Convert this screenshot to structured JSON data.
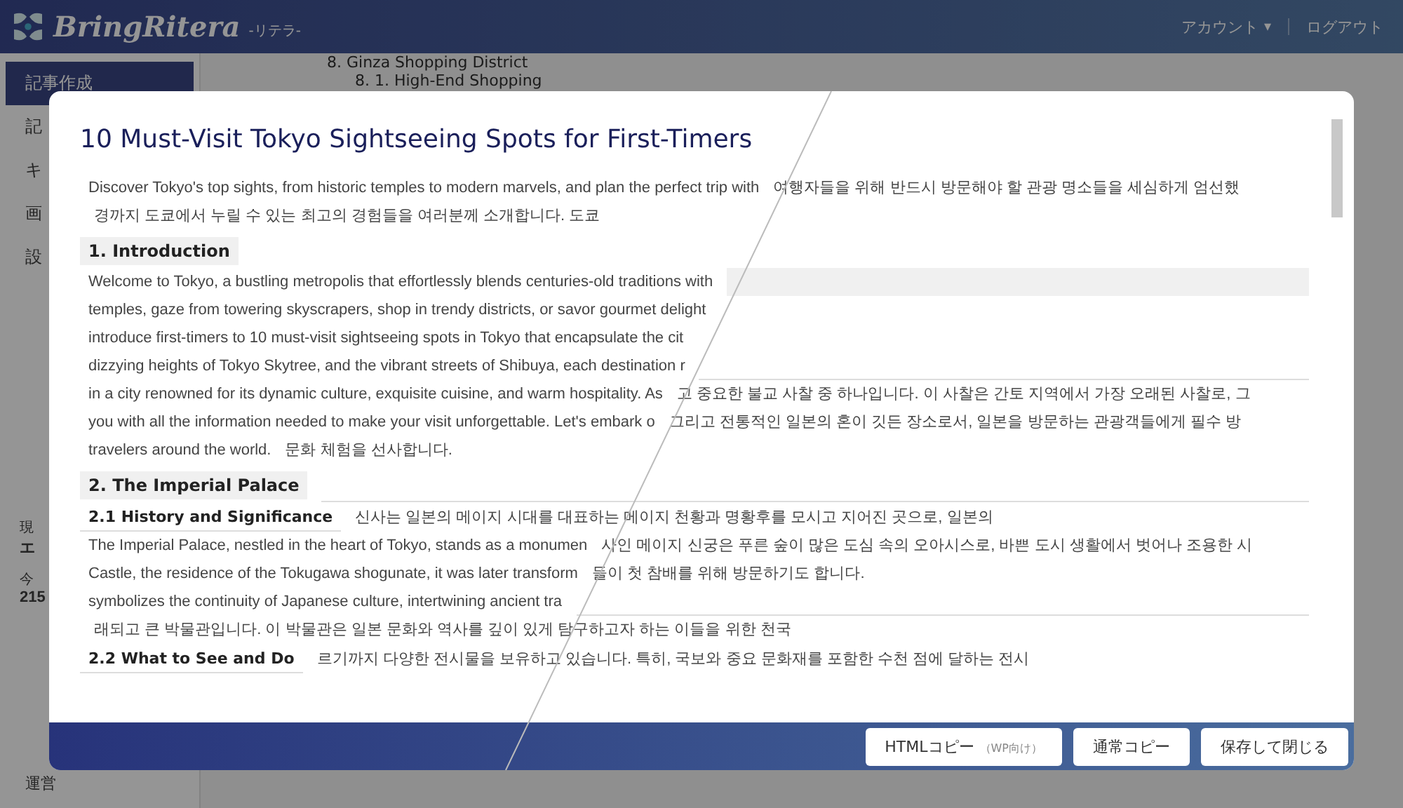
{
  "header": {
    "logo": "BringRitera",
    "logo_sub": "-リテラ-",
    "account": "アカウント",
    "account_caret": "▾",
    "logout": "ログアウト"
  },
  "sidebar": {
    "items": [
      {
        "label": "記事作成",
        "selected": true
      },
      {
        "label": "記",
        "selected": false
      },
      {
        "label": "キ",
        "selected": false
      },
      {
        "label": "画",
        "selected": false
      },
      {
        "label": "設",
        "selected": false
      }
    ],
    "stats": [
      {
        "label": "現",
        "value": "エ"
      },
      {
        "label": "今",
        "value": "215"
      }
    ],
    "footer_link": "運営"
  },
  "background": {
    "outline": [
      "8. Ginza Shopping District",
      "8. 1. High-End Shopping"
    ]
  },
  "modal": {
    "title": "10 Must-Visit Tokyo Sightseeing Spots for First-Timers",
    "rows": [
      {
        "left": {
          "kind": "body",
          "text": "Discover Tokyo's top sights, from historic temples to modern marvels, and plan the perfect trip with"
        },
        "right": {
          "kind": "body",
          "text": "여행자들을 위해 반드시 방문해야 할 관광 명소들을 세심하게 엄선했"
        }
      },
      {
        "left": {
          "kind": "blank"
        },
        "right": {
          "kind": "body",
          "text": "경까지 도쿄에서 누릴 수 있는 최고의 경험들을 여러분께 소개합니다. 도쿄"
        }
      },
      {
        "left": {
          "kind": "heading",
          "text": "1. Introduction"
        },
        "right": {
          "kind": "blank"
        }
      },
      {
        "left": {
          "kind": "body",
          "text": "Welcome to Tokyo, a bustling metropolis that effortlessly blends centuries-old traditions with"
        },
        "right": {
          "kind": "band"
        }
      },
      {
        "left": {
          "kind": "body",
          "text": "temples, gaze from towering skyscrapers, shop in trendy districts, or savor gourmet delight"
        },
        "right": {
          "kind": "blank"
        }
      },
      {
        "left": {
          "kind": "body",
          "text": "introduce first-timers to 10 must-visit sightseeing spots in Tokyo that encapsulate the cit"
        },
        "right": {
          "kind": "blank"
        }
      },
      {
        "left": {
          "kind": "body",
          "text": "dizzying heights of Tokyo Skytree, and the vibrant streets of Shibuya, each destination r"
        },
        "right": {
          "kind": "rule"
        }
      },
      {
        "left": {
          "kind": "body",
          "text": "in a city renowned for its dynamic culture, exquisite cuisine, and warm hospitality. As"
        },
        "right": {
          "kind": "body",
          "text": "고 중요한 불교 사찰 중 하나입니다. 이 사찰은 간토 지역에서 가장 오래된 사찰로, 그"
        }
      },
      {
        "left": {
          "kind": "body",
          "text": "you with all the information needed to make your visit unforgettable. Let's embark o"
        },
        "right": {
          "kind": "body",
          "text": "그리고 전통적인 일본의 혼이 깃든 장소로서, 일본을 방문하는 관광객들에게 필수 방"
        }
      },
      {
        "left": {
          "kind": "body",
          "text": "travelers around the world."
        },
        "right": {
          "kind": "body",
          "text": "문화 체험을 선사합니다."
        }
      },
      {
        "left": {
          "kind": "heading",
          "text": "2. The Imperial Palace"
        },
        "right": {
          "kind": "rule"
        }
      },
      {
        "left": {
          "kind": "subheading",
          "text": "2.1 History and Significance"
        },
        "right": {
          "kind": "body",
          "text": "신사는 일본의 메이지 시대를 대표하는 메이지 천황과 명황후를 모시고 지어진 곳으로, 일본의"
        }
      },
      {
        "left": {
          "kind": "body",
          "text": "The Imperial Palace, nestled in the heart of Tokyo, stands as a monumen"
        },
        "right": {
          "kind": "body",
          "text": "사인 메이지 신궁은 푸른 숲이 많은 도심 속의 오아시스로, 바쁜 도시 생활에서 벗어나 조용한 시"
        }
      },
      {
        "left": {
          "kind": "body",
          "text": "Castle, the residence of the Tokugawa shogunate, it was later transform"
        },
        "right": {
          "kind": "body",
          "text": "들이 첫 참배를 위해 방문하기도 합니다."
        }
      },
      {
        "left": {
          "kind": "body",
          "text": "symbolizes the continuity of Japanese culture, intertwining ancient tra"
        },
        "right": {
          "kind": "rule"
        }
      },
      {
        "left": {
          "kind": "blank"
        },
        "right": {
          "kind": "body",
          "text": "래되고 큰 박물관입니다. 이 박물관은 일본 문화와 역사를 깊이 있게 탐구하고자 하는 이들을 위한 천국"
        }
      },
      {
        "left": {
          "kind": "subheading",
          "text": "2.2 What to See and Do"
        },
        "right": {
          "kind": "body",
          "text": "르기까지 다양한 전시물을 보유하고 있습니다. 특히, 국보와 중요 문화재를 포함한 수천 점에 달하는 전시"
        }
      }
    ],
    "buttons": [
      {
        "label": "HTMLコピー",
        "note": "（WP向け）"
      },
      {
        "label": "通常コピー"
      },
      {
        "label": "保存して閉じる"
      }
    ]
  }
}
